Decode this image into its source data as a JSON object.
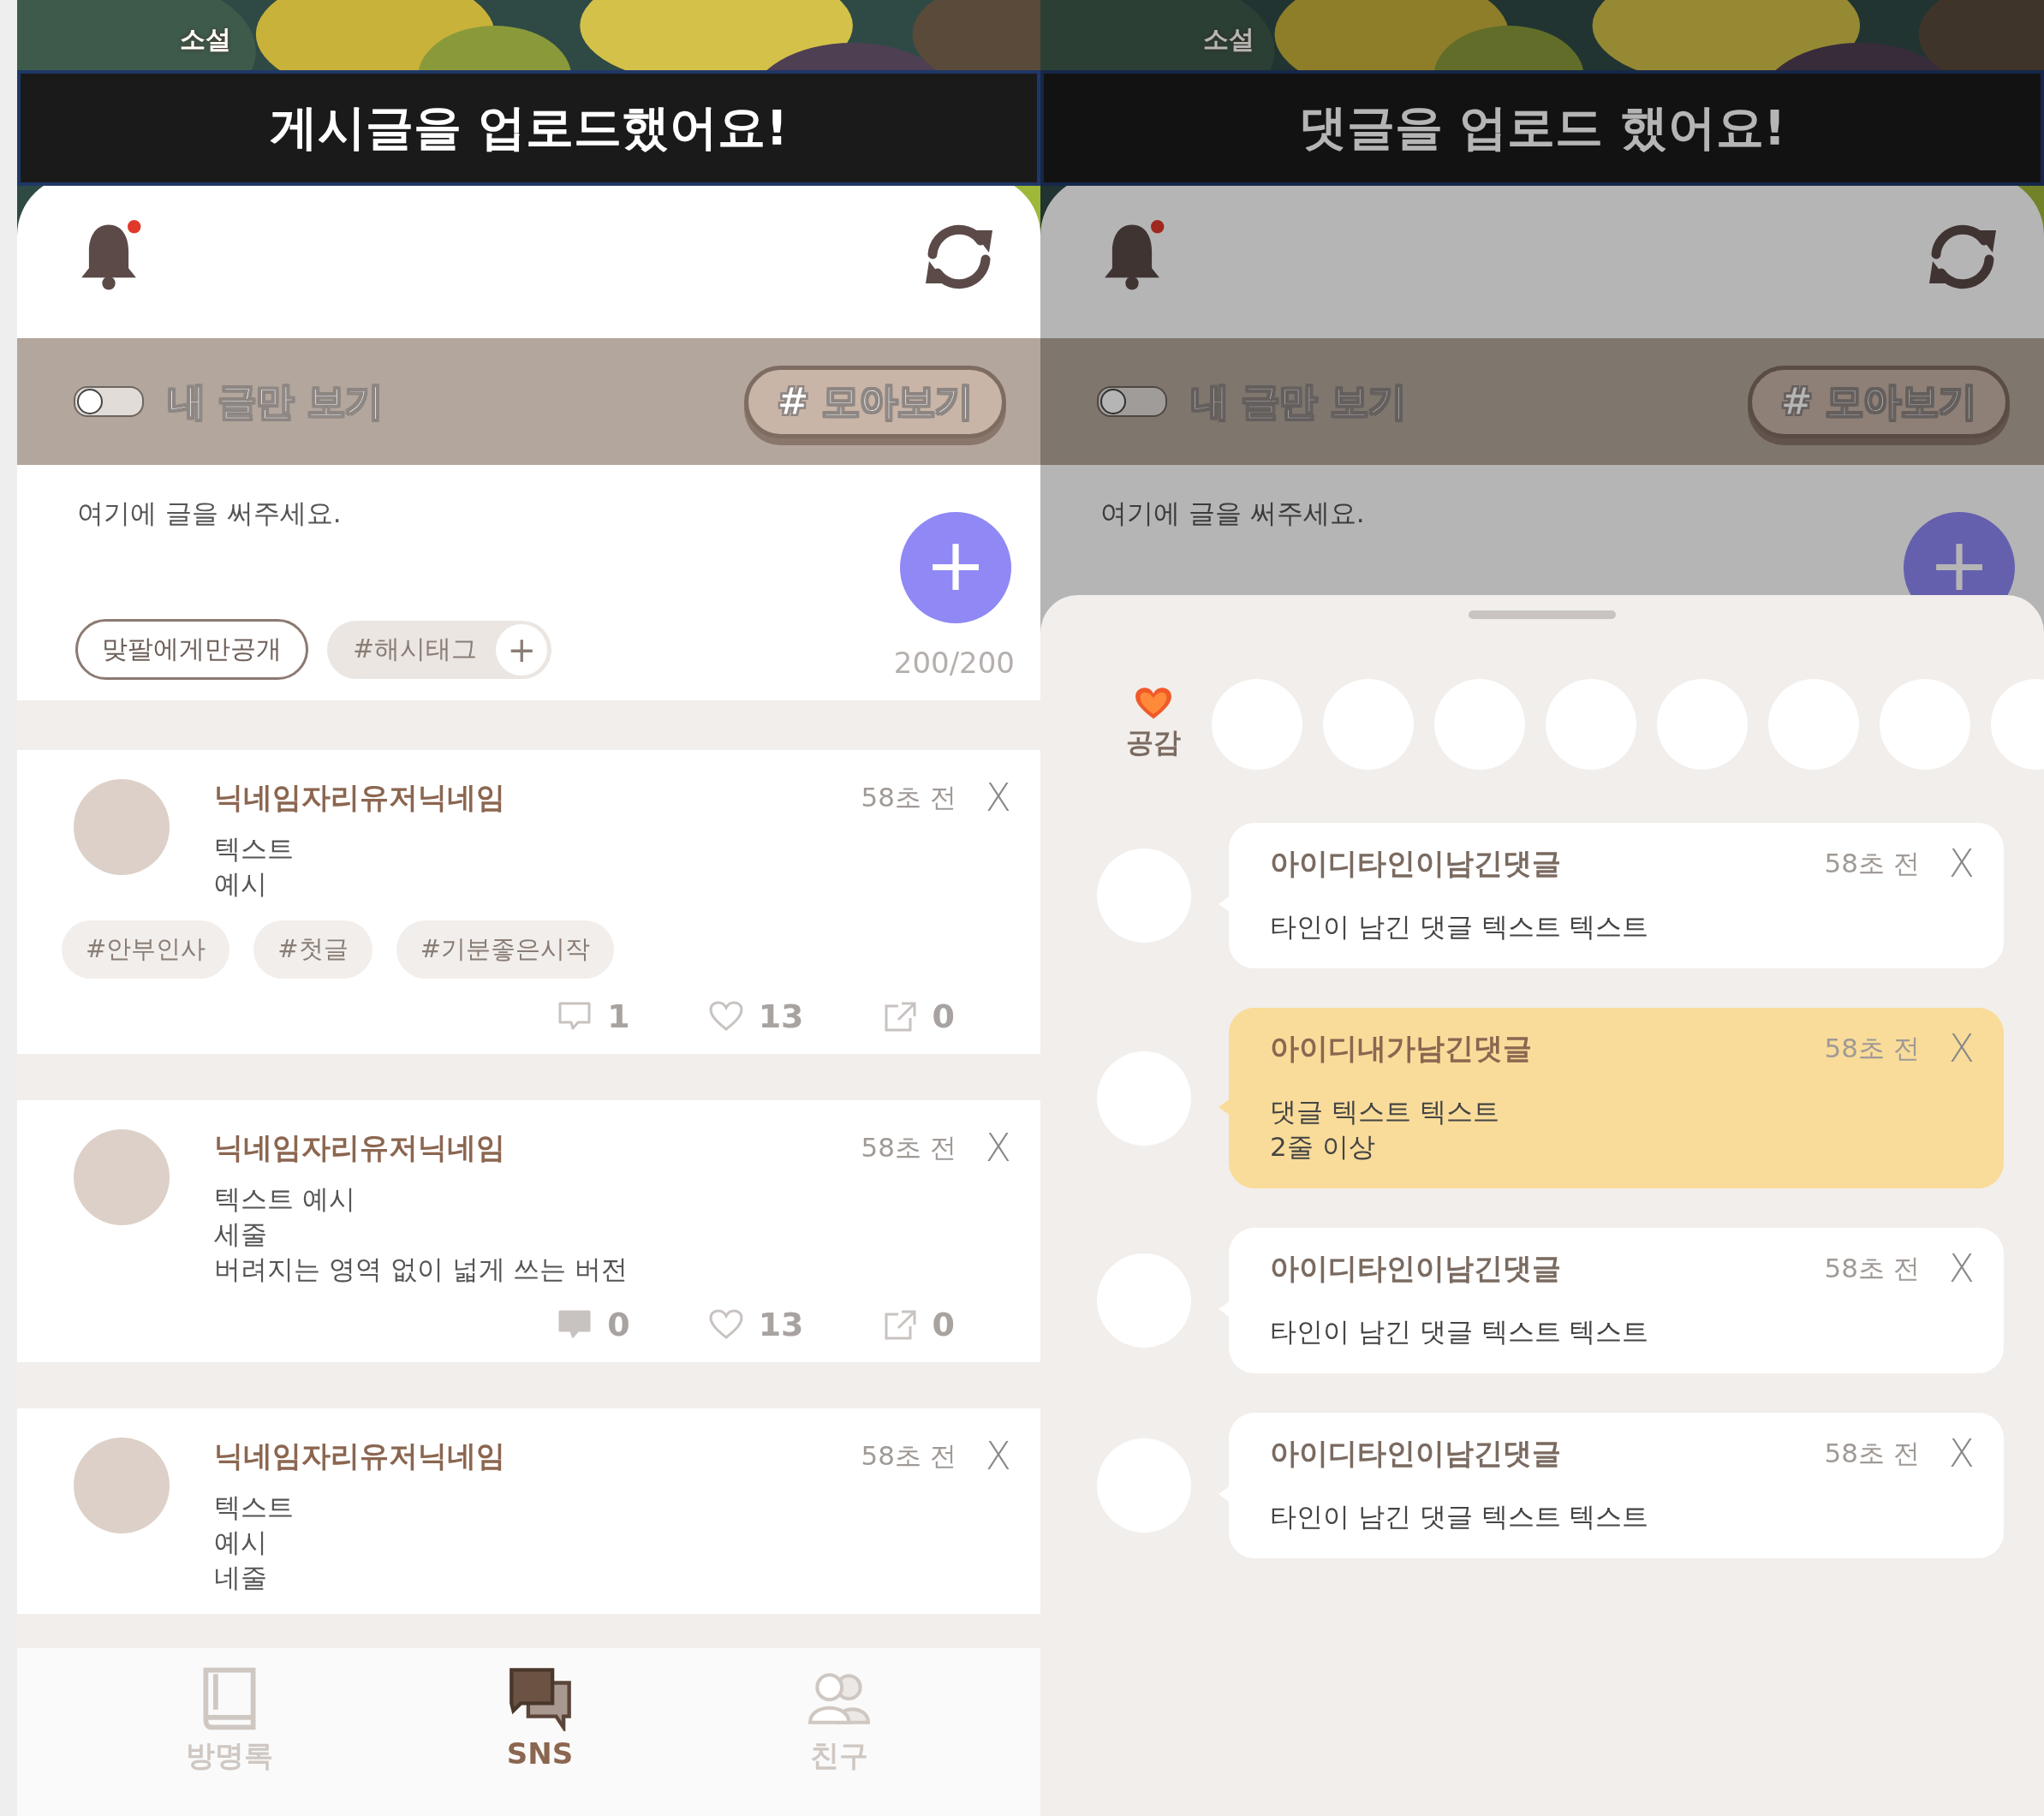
{
  "post_screen": {
    "background_label": "소설",
    "toast": "게시글을 업로드했어요!",
    "dimmed": false,
    "has_notification": true,
    "filter": {
      "toggle_label": "내 글만 보기",
      "my_posts_only": false,
      "collect_button": "# 모아보기"
    },
    "composer": {
      "placeholder": "여기에 글을 써주세요.",
      "add_button": "+",
      "visibility_chip": "맞팔에게만공개",
      "hashtag_chip": "#해시태그",
      "hashtag_add": "+",
      "counter": "200/200"
    },
    "posts": [
      {
        "nickname": "닉네임자리유저닉네임",
        "time": "58초 전",
        "close": "X",
        "lines": [
          "텍스트",
          "예시"
        ],
        "tags": [
          "#안부인사",
          "#첫글",
          "#기분좋은시작"
        ],
        "comments": "1",
        "comment_filled": false,
        "likes": "13",
        "shares": "0"
      },
      {
        "nickname": "닉네임자리유저닉네임",
        "time": "58초 전",
        "close": "X",
        "lines": [
          "텍스트 예시",
          "세줄",
          "버려지는 영역 없이 넓게 쓰는 버전"
        ],
        "comments": "0",
        "comment_filled": true,
        "likes": "13",
        "shares": "0"
      },
      {
        "nickname": "닉네임자리유저닉네임",
        "time": "58초 전",
        "close": "X",
        "lines": [
          "텍스트",
          "예시",
          "네줄"
        ]
      }
    ],
    "nav": [
      {
        "label": "방명록",
        "kind": "book",
        "selected": false
      },
      {
        "label": "SNS",
        "kind": "chat",
        "selected": true
      },
      {
        "label": "친구",
        "kind": "friends",
        "selected": false
      }
    ]
  },
  "comment_screen": {
    "background_label": "소설",
    "toast": "댓글을 업로드 했어요!",
    "dimmed": true,
    "has_notification": true,
    "filter": {
      "toggle_label": "내 글만 보기",
      "my_posts_only": false,
      "collect_button": "# 모아보기"
    },
    "composer": {
      "placeholder": "여기에 글을 써주세요.",
      "add_button": "+"
    },
    "sheet": {
      "reaction_label": "공감",
      "reaction_slots": [
        {
          "kind": "empty"
        },
        {
          "kind": "empty"
        },
        {
          "kind": "empty"
        },
        {
          "kind": "empty"
        },
        {
          "kind": "empty"
        },
        {
          "kind": "empty"
        },
        {
          "kind": "empty"
        },
        {
          "kind": "empty"
        }
      ],
      "comments": [
        {
          "author": "아이디타인이남긴댓글",
          "time": "58초 전",
          "close": "X",
          "lines": [
            "타인이 남긴 댓글 텍스트 텍스트"
          ],
          "mine": false
        },
        {
          "author": "아이디내가남긴댓글",
          "time": "58초 전",
          "close": "X",
          "lines": [
            "댓글 텍스트 텍스트",
            "2줄 이상"
          ],
          "mine": true
        },
        {
          "author": "아이디타인이남긴댓글",
          "time": "58초 전",
          "close": "X",
          "lines": [
            "타인이 남긴 댓글 텍스트 텍스트"
          ],
          "mine": false
        },
        {
          "author": "아이디타인이남긴댓글",
          "time": "58초 전",
          "close": "X",
          "lines": [
            "타인이 남긴 댓글 텍스트 텍스트"
          ],
          "mine": false
        }
      ]
    }
  }
}
